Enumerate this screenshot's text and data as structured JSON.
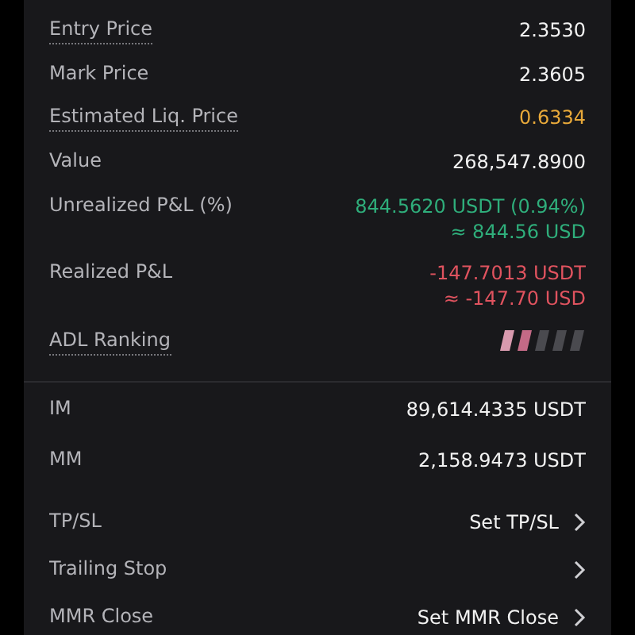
{
  "sections": [
    {
      "rows": [
        {
          "kind": "text",
          "label": "Entry Price",
          "dotted": true,
          "color": "#f2f2f2",
          "lines": [
            "2.3530"
          ]
        },
        {
          "kind": "text",
          "label": "Mark Price",
          "dotted": false,
          "color": "#f2f2f2",
          "lines": [
            "2.3605"
          ]
        },
        {
          "kind": "text",
          "label": "Estimated Liq. Price",
          "dotted": true,
          "color": "#e8a93a",
          "lines": [
            "0.6334"
          ]
        },
        {
          "kind": "text",
          "label": "Value",
          "dotted": false,
          "color": "#f2f2f2",
          "lines": [
            "268,547.8900"
          ]
        },
        {
          "kind": "text",
          "label": "Unrealized P&L (%)",
          "dotted": false,
          "color": "#2fae7b",
          "lines": [
            "844.5620 USDT (0.94%)",
            "≈ 844.56 USD"
          ]
        },
        {
          "kind": "text",
          "label": "Realized P&L",
          "dotted": false,
          "color": "#e0535f",
          "lines": [
            "-147.7013 USDT",
            "≈ -147.70 USD"
          ]
        },
        {
          "kind": "meter",
          "label": "ADL Ranking",
          "dotted": true,
          "level": 0.4
        }
      ]
    },
    {
      "rows": [
        {
          "kind": "text",
          "label": "IM",
          "dotted": false,
          "color": "#f2f2f2",
          "lines": [
            "89,614.4335 USDT"
          ]
        },
        {
          "kind": "text",
          "label": "MM",
          "dotted": false,
          "color": "#f2f2f2",
          "lines": [
            "2,158.9473 USDT"
          ]
        },
        {
          "kind": "link",
          "label": "TP/SL",
          "dotted": false,
          "action": "Set TP/SL"
        },
        {
          "kind": "link",
          "label": "Trailing Stop",
          "dotted": false
        },
        {
          "kind": "link",
          "label": "MMR Close",
          "dotted": false,
          "action": "Set MMR Close"
        }
      ]
    }
  ]
}
